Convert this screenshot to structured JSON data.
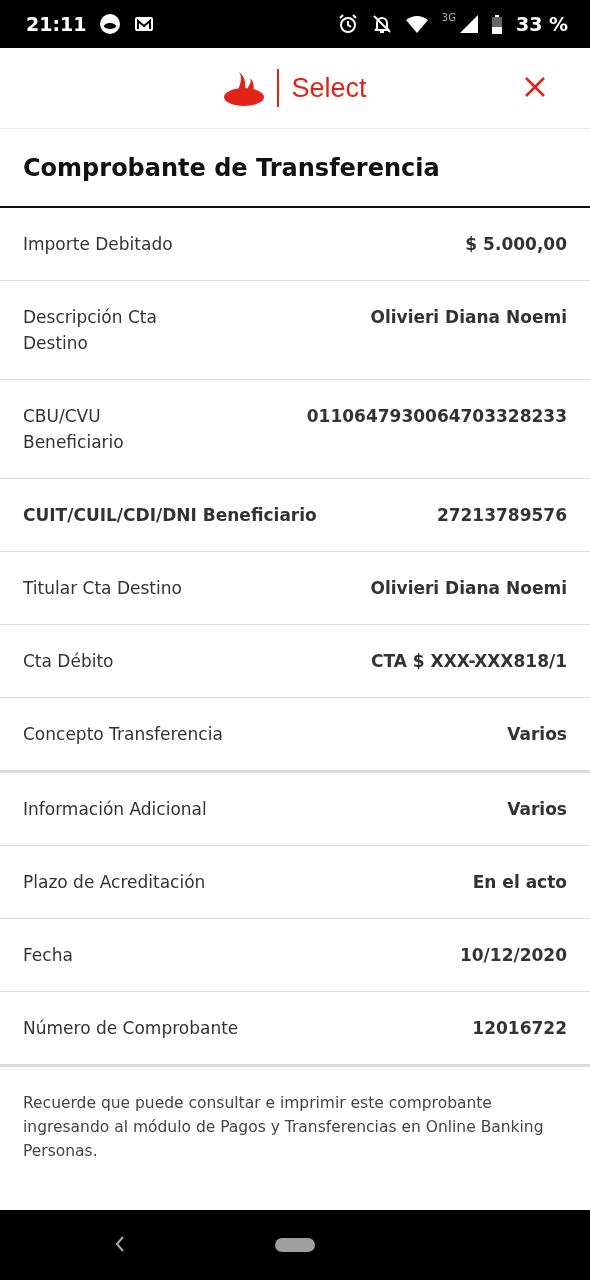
{
  "status_bar": {
    "time": "21:11",
    "network": "3G",
    "battery": "33 %"
  },
  "header": {
    "brand": "Select"
  },
  "title": "Comprobante de Transferencia",
  "rows": [
    {
      "kind": "plain",
      "label": "Importe Debitado",
      "value": "$ 5.000,00"
    },
    {
      "kind": "split",
      "label": "Descripción Cta Destino",
      "value": "Olivieri Diana Noemi"
    },
    {
      "kind": "split",
      "label": "CBU/CVU Beneficiario",
      "value": "0110647930064703328233"
    },
    {
      "kind": "strong",
      "label": "CUIT/CUIL/CDI/DNI Beneficiario",
      "value": "27213789576"
    },
    {
      "kind": "plain",
      "label": "Titular Cta Destino",
      "value": "Olivieri Diana Noemi"
    },
    {
      "kind": "plain",
      "label": "Cta Débito",
      "value": "CTA $ XXX-XXX818/1"
    },
    {
      "kind": "plain",
      "label": "Concepto Transferencia",
      "value": "Varios"
    },
    {
      "kind": "plain",
      "label": "Información Adicional",
      "value": "Varios"
    },
    {
      "kind": "plain",
      "label": "Plazo de Acreditación",
      "value": "En el acto"
    },
    {
      "kind": "plain",
      "label": "Fecha",
      "value": "10/12/2020"
    },
    {
      "kind": "plain",
      "label": "Número de Comprobante",
      "value": "12016722"
    }
  ],
  "footer_note": "Recuerde que puede consultar e imprimir este comprobante ingresando al módulo de Pagos y Transferencias en Online Banking Personas."
}
